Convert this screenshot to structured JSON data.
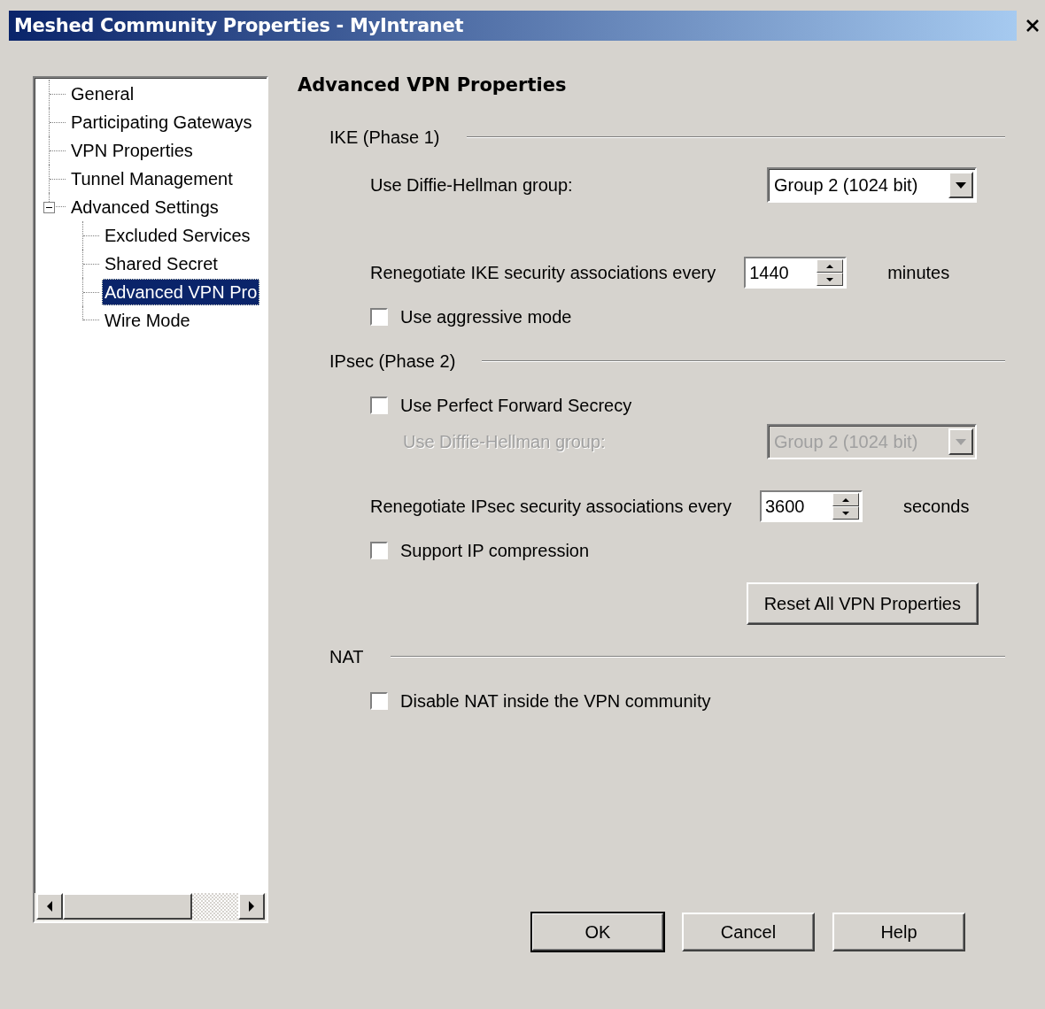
{
  "window": {
    "title": "Meshed Community Properties - MyIntranet"
  },
  "tree": [
    {
      "label": "General",
      "selected": false
    },
    {
      "label": "Participating Gateways",
      "selected": false
    },
    {
      "label": "VPN Properties",
      "selected": false
    },
    {
      "label": "Tunnel Management",
      "selected": false
    },
    {
      "label": "Advanced Settings",
      "selected": false,
      "expanded": true,
      "children": [
        {
          "label": "Excluded Services",
          "selected": false
        },
        {
          "label": "Shared Secret",
          "selected": false
        },
        {
          "label": "Advanced VPN Pro",
          "selected": true
        },
        {
          "label": "Wire Mode",
          "selected": false
        }
      ]
    }
  ],
  "page_title": "Advanced VPN Properties",
  "sections": [
    {
      "title": "IKE (Phase 1)",
      "items": [
        {
          "kind": "dropdown",
          "label": "Use Diffie-Hellman group:",
          "value": "Group 2 (1024 bit)",
          "disabled": false
        },
        {
          "kind": "spinner",
          "label": "Renegotiate IKE security associations every",
          "value": "1440",
          "unit": "minutes"
        },
        {
          "kind": "checkbox",
          "label": "Use aggressive mode",
          "checked": false
        }
      ]
    },
    {
      "title": "IPsec (Phase 2)",
      "items": [
        {
          "kind": "checkbox",
          "label": "Use Perfect Forward Secrecy",
          "checked": false,
          "children": [
            {
              "kind": "dropdown",
              "label": "Use Diffie-Hellman group:",
              "value": "Group 2 (1024 bit)",
              "disabled": true
            }
          ]
        },
        {
          "kind": "spinner",
          "label": "Renegotiate IPsec security associations every",
          "value": "3600",
          "unit": "seconds"
        },
        {
          "kind": "checkbox",
          "label": "Support IP compression",
          "checked": false
        },
        {
          "kind": "button",
          "label": "Reset All VPN Properties"
        }
      ]
    },
    {
      "title": "NAT",
      "items": [
        {
          "kind": "checkbox",
          "label": "Disable NAT inside the VPN community",
          "checked": false
        }
      ]
    }
  ],
  "buttons": [
    {
      "label": "OK",
      "default": true
    },
    {
      "label": "Cancel",
      "default": false
    },
    {
      "label": "Help",
      "default": false
    }
  ]
}
